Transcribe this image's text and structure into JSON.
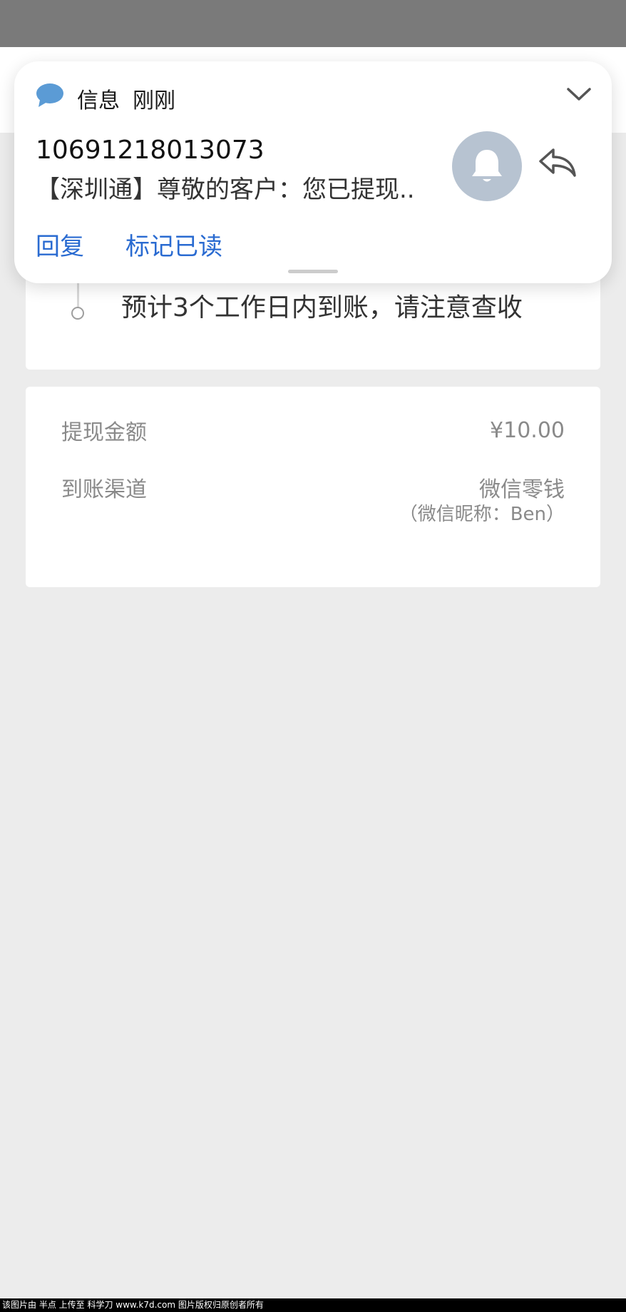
{
  "notification": {
    "app_name": "信息",
    "time": "刚刚",
    "sender": "10691218013073",
    "body": "【深圳通】尊敬的客户：您已提现..",
    "actions": [
      "回复",
      "标记已读"
    ]
  },
  "progress": {
    "text": "预计3个工作日内到账，请注意查收"
  },
  "details": {
    "rows": [
      {
        "label": "提现金额",
        "value": "¥10.00"
      },
      {
        "label": "到账渠道",
        "value": "微信零钱"
      }
    ],
    "nickname": "（微信昵称：Ben）"
  },
  "watermark": "该图片由 半点 上传至 科学刀 www.k7d.com 图片版权归原创者所有",
  "colors": {
    "accent": "#2a6bd1",
    "bell_bg": "#b7c3d1",
    "background": "#ececec",
    "status_bar": "#7a7a7a"
  }
}
